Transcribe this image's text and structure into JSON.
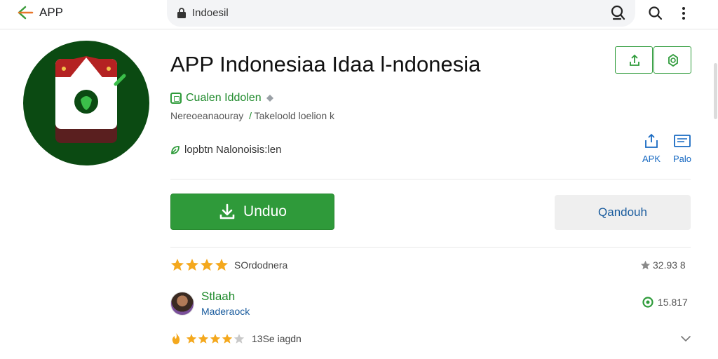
{
  "topbar": {
    "app_label": "APP",
    "url": "Indoesil"
  },
  "app": {
    "title": "APP Indonesiaa Idaa l-ndonesia",
    "developer": "Cualen Iddolen",
    "meta_prefix": "Nereoeanaouray",
    "meta_suffix": "Takeloold loelion k",
    "category": "lopbtn Nalonoisis:len"
  },
  "side_actions": {
    "apk_label": "APK",
    "pdf_label": "Palo"
  },
  "buttons": {
    "primary": "Unduo",
    "secondary": "Qandouh"
  },
  "ratings": {
    "row1_label": "SOrdodnera",
    "row1_score": "32.93 8",
    "reviewer_name": "Stlaah",
    "reviewer_sub": "Maderaock",
    "review_count": "15.817",
    "row2_label": "13Se iagdn"
  },
  "colors": {
    "brand_green": "#2f9a3a",
    "star": "#f4a81d",
    "link_blue": "#1769c2"
  },
  "icons": [
    "back-arrow-icon",
    "lock-icon",
    "search-icon",
    "more-vert-icon",
    "share-icon",
    "settings-icon",
    "apk-icon",
    "pdf-icon",
    "download-icon",
    "star-icon",
    "leaf-icon",
    "chevron-down-icon"
  ]
}
